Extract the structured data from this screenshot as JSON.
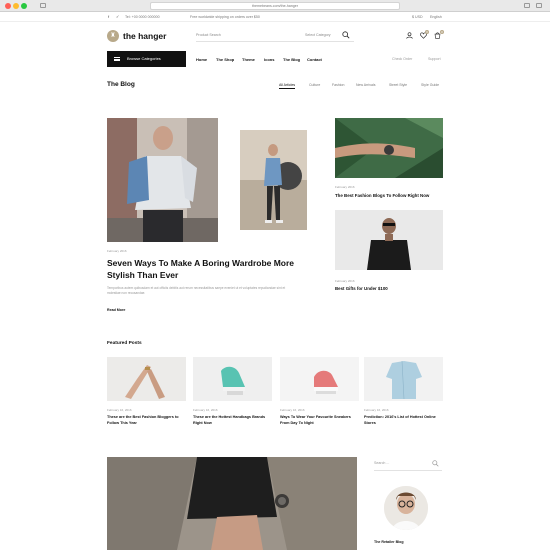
{
  "browser": {
    "url": "themebeans.com/the-hanger"
  },
  "topbar": {
    "phone": "Tel: +00 0000 000000",
    "shipping": "Free worldwide shipping on orders over $50",
    "currency": "$ USD",
    "language": "English"
  },
  "header": {
    "logo_text": "the hanger",
    "search_placeholder": "Product Search",
    "search_categories": "Select Category",
    "cart_count": "0",
    "wishlist_count": "0"
  },
  "nav": {
    "browse_label": "Browse Categories",
    "items": [
      "Home",
      "The Shop",
      "Theme",
      "Icons",
      "The Blog",
      "Contact"
    ],
    "right_items": [
      "Check Order",
      "Support"
    ]
  },
  "blog": {
    "title": "The Blog",
    "filters": [
      "All Articles",
      "Culture",
      "Fashion",
      "New Arrivals",
      "Street Style",
      "Style Guide"
    ],
    "main_post": {
      "date": "February 2016",
      "headline": "Seven Ways To Make A Boring Wardrobe More Stylish Than Ever",
      "excerpt": "Temporibus autem quibusdam et aut officiis debitis aut rerum necessitatibus saepe eveniet ut et voluptates repudiandae sint et molestiae non recusandae.",
      "read_more": "Read More"
    },
    "side_posts": [
      {
        "date": "February 2016",
        "headline": "The Best Fashion Blogs To Follow Right Now"
      },
      {
        "date": "February 2016",
        "headline": "Best Gifts for Under $100"
      }
    ]
  },
  "featured": {
    "title": "Featured Posts",
    "posts": [
      {
        "date": "February 16, 2016",
        "title": "These are the Best Fashion Bloggers to Follow This Year"
      },
      {
        "date": "February 16, 2016",
        "title": "These are the Hottest Handbags Brands Right Now"
      },
      {
        "date": "February 16, 2016",
        "title": "Ways To Wear Your Favourite Sneakers From Day To Night"
      },
      {
        "date": "February 16, 2016",
        "title": "Prediction: 2016's List of Hottest Online Stores"
      }
    ]
  },
  "sidebar": {
    "search_placeholder": "Search ...",
    "author_name": "The Retailer Blog"
  },
  "colors": {
    "accent": "#b8a98a",
    "dark": "#111111"
  }
}
